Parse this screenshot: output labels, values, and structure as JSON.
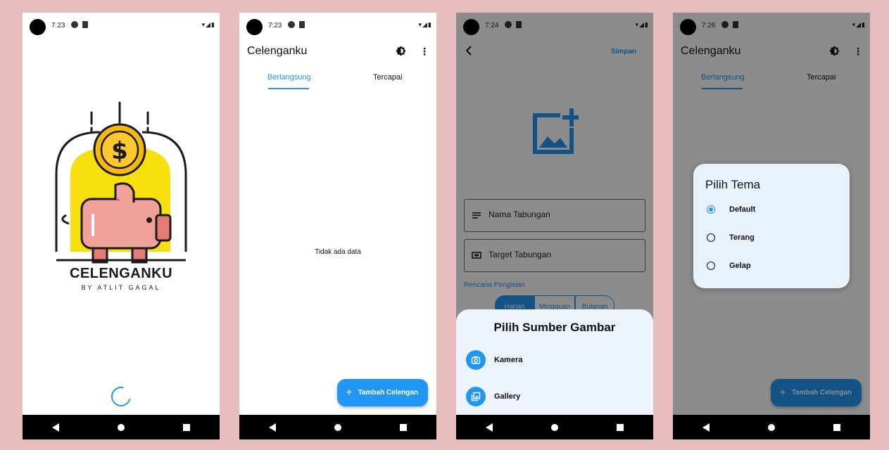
{
  "colors": {
    "accent": "#2196f3",
    "background": "#e6bcbc",
    "scrim": "rgba(0,0,0,0.45)",
    "sheet": "#eef4fb",
    "dialog": "#e8f2fb",
    "logo_yellow": "#f6df0c",
    "logo_pink": "#f0a29a"
  },
  "screens": {
    "splash": {
      "time": "7:23",
      "logo_title": "CELENGANKU",
      "logo_subtitle": "BY ATLIT GAGAL",
      "loading": true
    },
    "home": {
      "time": "7:23",
      "app_title": "Celenganku",
      "tabs": [
        {
          "label": "Berlangsung",
          "active": true
        },
        {
          "label": "Tercapai",
          "active": false
        }
      ],
      "empty_text": "Tidak ada data",
      "fab_label": "Tambah Celengan",
      "icons": [
        "theme-icon",
        "more-vert-icon",
        "add-icon"
      ]
    },
    "add_form": {
      "time": "7:24",
      "save_label": "Simpan",
      "fields": [
        {
          "label": "Nama Tabungan",
          "icon": "notes-icon"
        },
        {
          "label": "Target Tabungan",
          "icon": "money-icon"
        }
      ],
      "plan_label": "Rencana Pengisian",
      "plan_options": [
        "Harian",
        "Mingguan",
        "Bulanan"
      ],
      "plan_selected": "Harian",
      "sheet": {
        "title": "Pilih Sumber Gambar",
        "items": [
          {
            "label": "Kamera",
            "icon": "camera-icon"
          },
          {
            "label": "Gallery",
            "icon": "gallery-icon"
          }
        ]
      }
    },
    "theme_dialog": {
      "time": "7:26",
      "app_title": "Celenganku",
      "tabs": [
        {
          "label": "Berlangsung",
          "active": true
        },
        {
          "label": "Tercapai",
          "active": false
        }
      ],
      "fab_label": "Tambah Celengan",
      "dialog": {
        "title": "Pilih Tema",
        "options": [
          {
            "label": "Default",
            "selected": true
          },
          {
            "label": "Terang",
            "selected": false
          },
          {
            "label": "Gelap",
            "selected": false
          }
        ]
      }
    }
  }
}
